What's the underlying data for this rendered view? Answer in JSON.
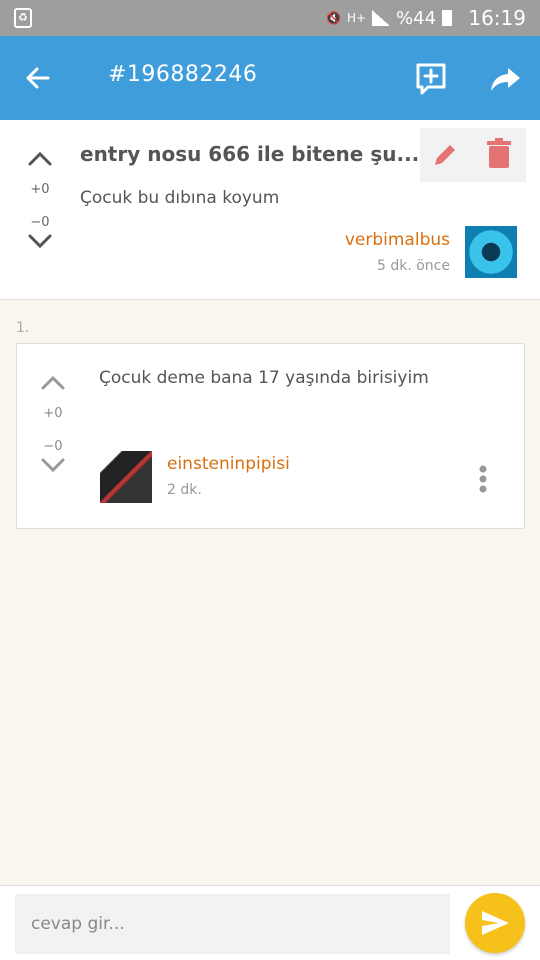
{
  "status_bar": {
    "signal_label": "H+",
    "battery_percent": "%44",
    "time": "16:19"
  },
  "app_bar": {
    "title": "#196882246",
    "icons": [
      "back-arrow-icon",
      "add-comment-icon",
      "share-icon"
    ]
  },
  "entry": {
    "title": "entry nosu 666 ile bitene şu...",
    "content": "Çocuk bu dıbına koyum",
    "upvotes": "+0",
    "downvotes": "−0",
    "author": "verbimalbus",
    "time": "5 dk. önce",
    "actions": [
      "edit-icon",
      "delete-icon"
    ],
    "colors": {
      "edit": "#e57373",
      "delete": "#e57373"
    }
  },
  "replies": {
    "section_number": "1.",
    "items": [
      {
        "content": "Çocuk deme bana 17 yaşında birisiyim",
        "upvotes": "+0",
        "downvotes": "−0",
        "author": "einsteninpipisi",
        "time": "2 dk."
      }
    ]
  },
  "reply_input": {
    "placeholder": "cevap gir...",
    "value": ""
  },
  "colors": {
    "app_bar": "#3f9ddb",
    "author": "#d9700f",
    "send_button": "#f5c11a",
    "background": "#f8f6ef"
  }
}
